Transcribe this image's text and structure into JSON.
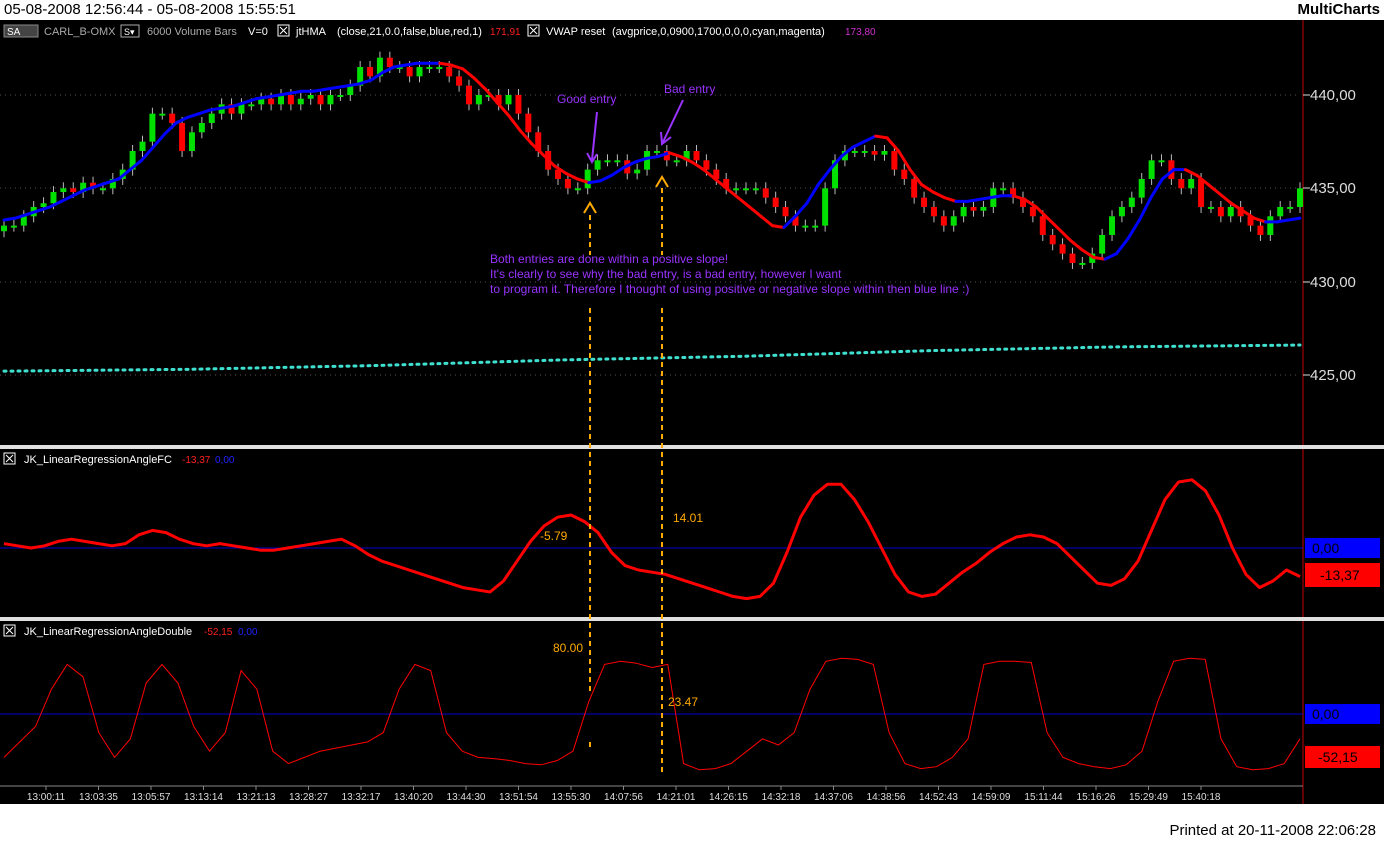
{
  "header": {
    "date_range": "05-08-2008 12:56:44 - 05-08-2008 15:55:51",
    "brand": "MultiCharts"
  },
  "footer": {
    "printed": "Printed at 20-11-2008 22:06:28"
  },
  "price_panel": {
    "symbol_box": "SA",
    "symbol": "CARL_B-OMX",
    "resolution": "6000 Volume Bars",
    "volume": "V=0",
    "study1_name": "jtHMA",
    "study1_params": "(close,21,0.0,false,blue,red,1)",
    "study1_value": "171,91",
    "study2_name": "VWAP reset",
    "study2_params": "(avgprice,0,0900,1700,0,0,0,cyan,magenta)",
    "study2_value": "173,80",
    "y_ticks": [
      "440,00",
      "435,00",
      "430,00",
      "425,00"
    ],
    "annotations": {
      "good_entry": "Good entry",
      "bad_entry": "Bad entry",
      "note_line1": "Both entries are done within a positive slope!",
      "note_line2": "It's clearly to see why the bad entry, is a bad entry, however I want",
      "note_line3": "to program it. Therefore I thought of using positive or negative slope within then blue line :)"
    }
  },
  "panel2": {
    "name": "JK_LinearRegressionAngleFC",
    "value1": "-13,37",
    "value2": "0,00",
    "label_zero": "0,00",
    "label_value": "-13,37",
    "annot_left": "-5.79",
    "annot_right": "14.01"
  },
  "panel3": {
    "name": "JK_LinearRegressionAngleDouble",
    "value1": "-52,15",
    "value2": "0,00",
    "label_zero": "0,00",
    "label_value": "-52,15",
    "annot_left": "80.00",
    "annot_right": "23.47"
  },
  "x_axis": [
    "13:00:11",
    "13:03:35",
    "13:05:57",
    "13:13:14",
    "13:21:13",
    "13:28:27",
    "13:32:17",
    "13:40:20",
    "13:44:30",
    "13:51:54",
    "13:55:30",
    "14:07:56",
    "14:21:01",
    "14:26:15",
    "14:32:18",
    "14:37:06",
    "14:38:56",
    "14:52:43",
    "14:59:09",
    "15:11:44",
    "15:16:26",
    "15:29:49",
    "15:40:18"
  ],
  "colors": {
    "background": "#000000",
    "up_bar": "#00e000",
    "down_bar": "#ff0000",
    "hma_up": "#0000ff",
    "hma_down": "#ff0000",
    "vwap": "#40e0d0",
    "annotation": "#9933ff",
    "guide": "#ffaa00",
    "zero_line": "#0000cc"
  },
  "chart_data": [
    {
      "type": "candlestick",
      "title": "CARL_B-OMX 6000 Volume Bars",
      "ylim": [
        421.5,
        443.5
      ],
      "y_ticks": [
        440,
        435,
        430,
        425
      ],
      "x_tick_labels": [
        "13:00:11",
        "13:03:35",
        "13:05:57",
        "13:13:14",
        "13:21:13",
        "13:28:27",
        "13:32:17",
        "13:40:20",
        "13:44:30",
        "13:51:54",
        "13:55:30",
        "14:07:56",
        "14:21:01",
        "14:26:15",
        "14:32:18",
        "14:37:06",
        "14:38:56",
        "14:52:43",
        "14:59:09",
        "15:11:44",
        "15:16:26",
        "15:29:49",
        "15:40:18"
      ],
      "close": [
        433.0,
        433.0,
        433.5,
        434.0,
        434.2,
        434.8,
        435.0,
        434.8,
        435.3,
        435.0,
        435.0,
        435.5,
        436.0,
        437.0,
        437.5,
        439.0,
        439.0,
        438.5,
        437.0,
        438.0,
        438.5,
        439.0,
        439.5,
        439.0,
        439.5,
        439.5,
        439.8,
        439.5,
        440.0,
        439.5,
        439.8,
        440.0,
        439.5,
        440.0,
        440.0,
        440.5,
        441.5,
        441.0,
        442.0,
        441.5,
        441.5,
        441.0,
        441.5,
        441.5,
        441.5,
        441.0,
        440.5,
        439.5,
        440.0,
        440.0,
        439.5,
        440.0,
        439.0,
        438.0,
        437.0,
        436.0,
        435.5,
        435.0,
        435.0,
        436.0,
        436.5,
        436.5,
        436.5,
        435.8,
        436.0,
        437.0,
        437.0,
        436.5,
        436.5,
        437.0,
        436.5,
        436.0,
        435.5,
        435.0,
        435.0,
        435.0,
        435.0,
        434.5,
        434.0,
        433.5,
        433.0,
        433.0,
        433.0,
        435.0,
        436.5,
        437.0,
        437.0,
        437.0,
        436.8,
        437.0,
        436.0,
        435.5,
        434.5,
        434.0,
        433.5,
        433.0,
        433.5,
        434.0,
        433.8,
        434.0,
        435.0,
        435.0,
        434.5,
        434.0,
        433.5,
        432.5,
        432.0,
        431.5,
        431.0,
        431.0,
        431.5,
        432.5,
        433.5,
        434.0,
        434.5,
        435.5,
        436.5,
        436.5,
        435.5,
        435.0,
        435.5,
        434.0,
        434.0,
        433.5,
        434.0,
        433.5,
        433.0,
        432.5,
        433.5,
        434.0,
        434.0,
        435.0
      ],
      "hma": [
        433.3,
        433.4,
        433.6,
        433.8,
        434.0,
        434.3,
        434.6,
        434.9,
        435.1,
        435.3,
        435.5,
        436.0,
        436.5,
        437.2,
        437.9,
        438.5,
        438.8,
        439.0,
        439.2,
        439.3,
        439.4,
        439.6,
        439.8,
        439.9,
        440.0,
        440.1,
        440.2,
        440.2,
        440.3,
        440.4,
        440.5,
        440.6,
        440.8,
        441.2,
        441.5,
        441.6,
        441.7,
        441.7,
        441.7,
        441.6,
        441.4,
        440.9,
        440.3,
        439.6,
        438.9,
        438.1,
        437.4,
        436.8,
        436.2,
        435.8,
        435.5,
        435.3,
        435.4,
        435.7,
        436.1,
        436.4,
        436.6,
        436.7,
        436.9,
        436.7,
        436.4,
        436.0,
        435.5,
        435.0,
        434.5,
        434.0,
        433.5,
        433.0,
        432.9,
        433.5,
        434.2,
        435.2,
        436.0,
        436.7,
        437.2,
        437.5,
        437.8,
        437.7,
        437.0,
        436.0,
        435.2,
        434.8,
        434.5,
        434.3,
        434.3,
        434.4,
        434.5,
        434.6,
        434.6,
        434.4,
        434.0,
        433.4,
        432.8,
        432.2,
        431.7,
        431.3,
        431.2,
        431.5,
        432.3,
        433.3,
        434.5,
        435.5,
        436.0,
        436.0,
        435.7,
        435.2,
        434.7,
        434.2,
        433.8,
        433.4,
        433.2,
        433.2,
        433.3,
        433.4
      ],
      "vwap": [
        425.2,
        425.3,
        425.5,
        425.8,
        426.0,
        426.3,
        426.5,
        426.6
      ]
    },
    {
      "type": "line",
      "title": "JK_LinearRegressionAngleFC",
      "ylim": [
        -40,
        40
      ],
      "zero_line": 0,
      "values": [
        2,
        1,
        0,
        1,
        3,
        4,
        3,
        2,
        1,
        2,
        6,
        8,
        7,
        4,
        2,
        1,
        2,
        1,
        0,
        -1,
        -1,
        0,
        1,
        2,
        3,
        4,
        1,
        -3,
        -6,
        -8,
        -10,
        -12,
        -14,
        -16,
        -18,
        -19,
        -20,
        -15,
        -6,
        3,
        10,
        14,
        15,
        12,
        7,
        -2,
        -8,
        -10,
        -11,
        -12,
        -14,
        -16,
        -18,
        -20,
        -22,
        -23,
        -22,
        -16,
        -2,
        14,
        24,
        29,
        29,
        22,
        12,
        0,
        -12,
        -20,
        -22,
        -21,
        -16,
        -11,
        -7,
        -2,
        2,
        5,
        6,
        5,
        2,
        -4,
        -10,
        -16,
        -17,
        -14,
        -6,
        8,
        22,
        30,
        31,
        26,
        15,
        0,
        -12,
        -18,
        -15,
        -10,
        -13
      ]
    },
    {
      "type": "line",
      "title": "JK_LinearRegressionAngleDouble",
      "ylim": [
        -60,
        90
      ],
      "zero_line": 0,
      "values": [
        -70,
        -45,
        -20,
        40,
        80,
        60,
        -30,
        -70,
        -40,
        50,
        80,
        50,
        -20,
        -60,
        -30,
        70,
        40,
        -60,
        -80,
        -70,
        -60,
        -55,
        -50,
        -45,
        -30,
        40,
        80,
        70,
        -30,
        -60,
        -70,
        -72,
        -75,
        -80,
        -82,
        -75,
        -60,
        20,
        80,
        85,
        82,
        75,
        80,
        -80,
        -90,
        -88,
        -80,
        -60,
        -40,
        -50,
        -30,
        40,
        85,
        90,
        88,
        80,
        -30,
        -80,
        -88,
        -85,
        -70,
        -40,
        80,
        85,
        85,
        83,
        -30,
        -70,
        -80,
        -85,
        -88,
        -82,
        -60,
        20,
        85,
        90,
        88,
        -40,
        -85,
        -90,
        -88,
        -80,
        -40
      ]
    }
  ]
}
